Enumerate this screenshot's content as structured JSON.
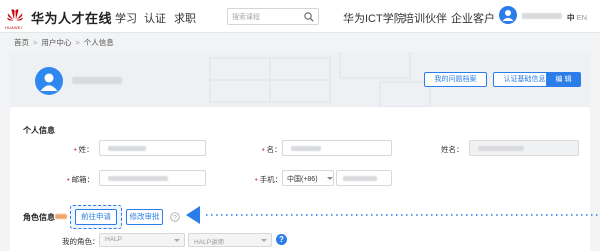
{
  "header": {
    "logo_caption": "HUAWEI",
    "brand": "华为人才在线",
    "nav_left": [
      "学习",
      "认证",
      "求职"
    ],
    "search_placeholder": "搜索课程",
    "nav_right": [
      "华为ICT学院",
      "培训伙伴",
      "企业客户"
    ],
    "lang_active": "中",
    "lang_other": "EN"
  },
  "breadcrumb": [
    "首页",
    "用户中心",
    "个人信息"
  ],
  "profile_band": {
    "buttons": [
      "我的问题档案",
      "认证基础信息",
      "编 辑"
    ]
  },
  "personal_info": {
    "title": "个人信息",
    "fields": {
      "surname_label": "姓：",
      "given_name_label": "名：",
      "fullname_label": "姓名：",
      "email_label": "邮箱：",
      "mobile_label": "手机：",
      "mobile_prefix": "中国(+86)"
    }
  },
  "role_info": {
    "title": "角色信息",
    "apply_button": "前往申请",
    "modify_button": "修改审批",
    "my_role_label": "我的角色：",
    "role_select_1": "HALP",
    "role_select_2": "HALP讲师"
  },
  "colors": {
    "accent": "#2b7de9",
    "brand_red": "#c7000b",
    "required": "#e4393c"
  }
}
